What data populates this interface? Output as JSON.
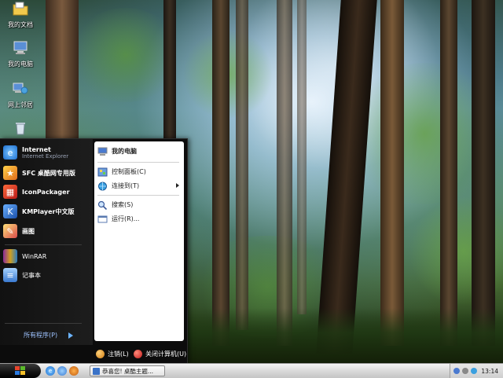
{
  "desktop_icons": [
    {
      "label": "我的文档",
      "icon": "folder-documents-icon"
    },
    {
      "label": "我的电脑",
      "icon": "my-computer-icon"
    },
    {
      "label": "网上邻居",
      "icon": "network-places-icon"
    },
    {
      "label": "",
      "icon": "recycle-bin-icon"
    }
  ],
  "start_menu": {
    "pinned": [
      {
        "name": "Internet",
        "sub": "Internet Explorer",
        "icon": "internet-explorer-icon"
      },
      {
        "name": "SFC 桌酷网专用版",
        "icon": "sfc-icon"
      },
      {
        "name": "IconPackager",
        "icon": "iconpackager-icon"
      },
      {
        "name": "KMPlayer中文版",
        "icon": "kmplayer-icon"
      },
      {
        "name": "画图",
        "icon": "paint-icon"
      }
    ],
    "recent": [
      {
        "name": "WinRAR",
        "icon": "winrar-icon"
      },
      {
        "name": "记事本",
        "icon": "notepad-icon"
      }
    ],
    "all_programs": "所有程序(P)",
    "right": [
      {
        "label": "我的电脑",
        "icon": "my-computer-icon"
      },
      {
        "label": "控制面板(C)",
        "icon": "control-panel-icon"
      },
      {
        "label": "连接到(T)",
        "icon": "connect-to-icon"
      },
      {
        "label": "搜索(S)",
        "icon": "search-icon"
      },
      {
        "label": "运行(R)...",
        "icon": "run-icon"
      }
    ],
    "logoff": "注销(L)",
    "shutdown": "关闭计算机(U)"
  },
  "taskbar": {
    "task_label": "恭喜您! 桌酷主题...",
    "clock": "13:14"
  }
}
